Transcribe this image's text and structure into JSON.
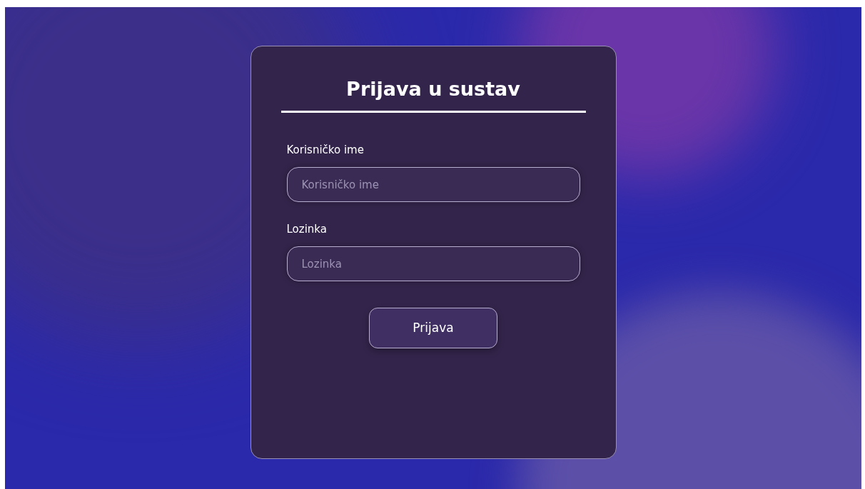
{
  "title": "Prijava u sustav",
  "fields": [
    {
      "label": "Korisničko ime",
      "placeholder": "Korisničko ime"
    },
    {
      "label": "Lozinka",
      "placeholder": "Lozinka"
    }
  ],
  "button": "Prijava"
}
